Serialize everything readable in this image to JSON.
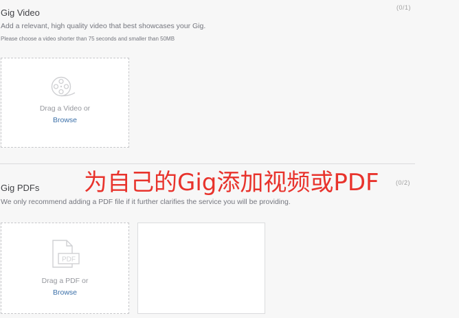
{
  "video": {
    "title": "Gig Video",
    "counter": "(0/1)",
    "description": "Add a relevant, high quality video that best showcases your Gig.",
    "note": "Please choose a video shorter than 75 seconds and smaller than 50MB",
    "drop_text": "Drag a Video or",
    "browse_label": "Browse"
  },
  "pdf": {
    "title": "Gig PDFs",
    "counter": "(0/2)",
    "description": "We only recommend adding a PDF file if it further clarifies the service you will be providing.",
    "drop_text": "Drag a PDF or",
    "browse_label": "Browse",
    "icon_label": "PDF"
  },
  "overlay": {
    "caption": "为自己的Gig添加视频或PDF",
    "color": "#e8332c"
  },
  "colors": {
    "link": "#3a6fa8",
    "border_dashed": "#c5c6c9"
  }
}
